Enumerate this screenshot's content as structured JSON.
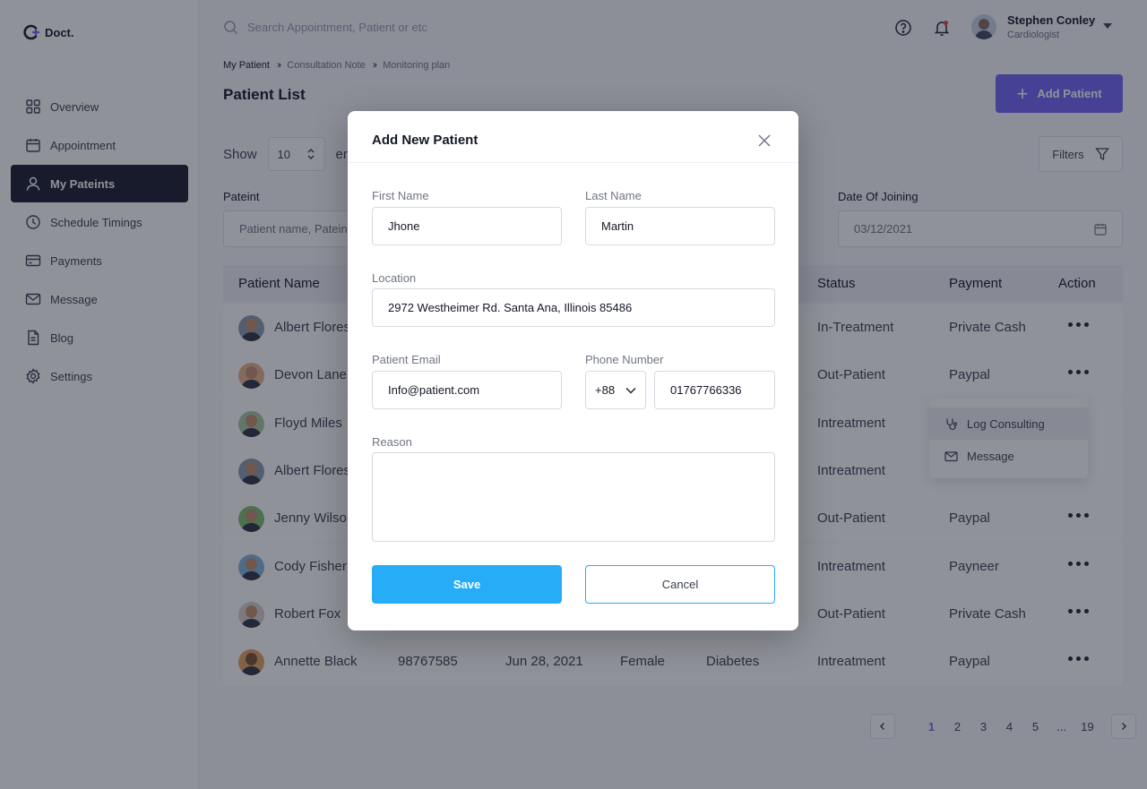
{
  "app": {
    "brand": "Doct."
  },
  "sidebar": {
    "items": [
      {
        "label": "Overview",
        "icon": "grid-icon"
      },
      {
        "label": "Appointment",
        "icon": "calendar-icon"
      },
      {
        "label": "My Pateints",
        "icon": "user-icon",
        "active": true
      },
      {
        "label": "Schedule Timings",
        "icon": "clock-icon"
      },
      {
        "label": "Payments",
        "icon": "card-icon"
      },
      {
        "label": "Message",
        "icon": "mail-icon"
      },
      {
        "label": "Blog",
        "icon": "document-icon"
      },
      {
        "label": "Settings",
        "icon": "gear-icon"
      }
    ]
  },
  "header": {
    "search_placeholder": "Search Appointment, Patient or etc",
    "user_name": "Stephen Conley",
    "user_role": "Cardiologist"
  },
  "breadcrumb": [
    "My Patient",
    "Consultation Note",
    "Monitoring plan"
  ],
  "page": {
    "title": "Patient List",
    "add_button": "Add Patient",
    "show_label": "Show",
    "show_value": "10",
    "entries_label": "entries",
    "filters_label": "Filters",
    "filter_patient_label": "Pateint",
    "filter_patient_placeholder": "Patient name, Pateint ID",
    "filter_date_label": "Date Of Joining",
    "filter_date_value": "03/12/2021"
  },
  "table": {
    "headers": {
      "name": "Patient Name",
      "status": "Status",
      "payment": "Payment",
      "action": "Action"
    },
    "rows": [
      {
        "name": "Albert Flores",
        "status": "In-Treatment",
        "payment": "Private Cash"
      },
      {
        "name": "Devon Lane",
        "status": "Out-Patient",
        "payment": "Paypal"
      },
      {
        "name": "Floyd Miles",
        "status": "Intreatment",
        "payment": ""
      },
      {
        "name": "Albert Flores",
        "status": "Intreatment",
        "payment": ""
      },
      {
        "name": "Jenny Wilson",
        "status": "Out-Patient",
        "payment": "Paypal"
      },
      {
        "name": "Cody Fisher",
        "status": "Intreatment",
        "payment": "Payneer"
      },
      {
        "name": "Robert Fox",
        "status": "Out-Patient",
        "payment": "Private Cash"
      },
      {
        "name": "Annette Black",
        "id": "98767585",
        "date": "Jun 28, 2021",
        "gender": "Female",
        "disease": "Diabetes",
        "status": "Intreatment",
        "payment": "Paypal"
      }
    ]
  },
  "row_menu": {
    "log": "Log Consulting",
    "message": "Message"
  },
  "pagination": {
    "pages": [
      "1",
      "2",
      "3",
      "4",
      "5",
      "...",
      "19"
    ],
    "active": "1"
  },
  "modal": {
    "title": "Add New Patient",
    "first_name_label": "First Name",
    "first_name_value": "Jhone",
    "last_name_label": "Last Name",
    "last_name_value": "Martin",
    "location_label": "Location",
    "location_value": "2972 Westheimer Rd. Santa Ana, Illinois 85486",
    "email_label": "Patient Email",
    "email_value": "Info@patient.com",
    "phone_label": "Phone Number",
    "phone_code": "+88",
    "phone_value": "01767766336",
    "reason_label": "Reason",
    "reason_value": "",
    "save_label": "Save",
    "cancel_label": "Cancel"
  },
  "colors": {
    "primary": "#6f66f7",
    "save": "#27acf7",
    "sidebar_active": "#171b2c",
    "overlay": "rgba(24,28,44,0.48)"
  }
}
